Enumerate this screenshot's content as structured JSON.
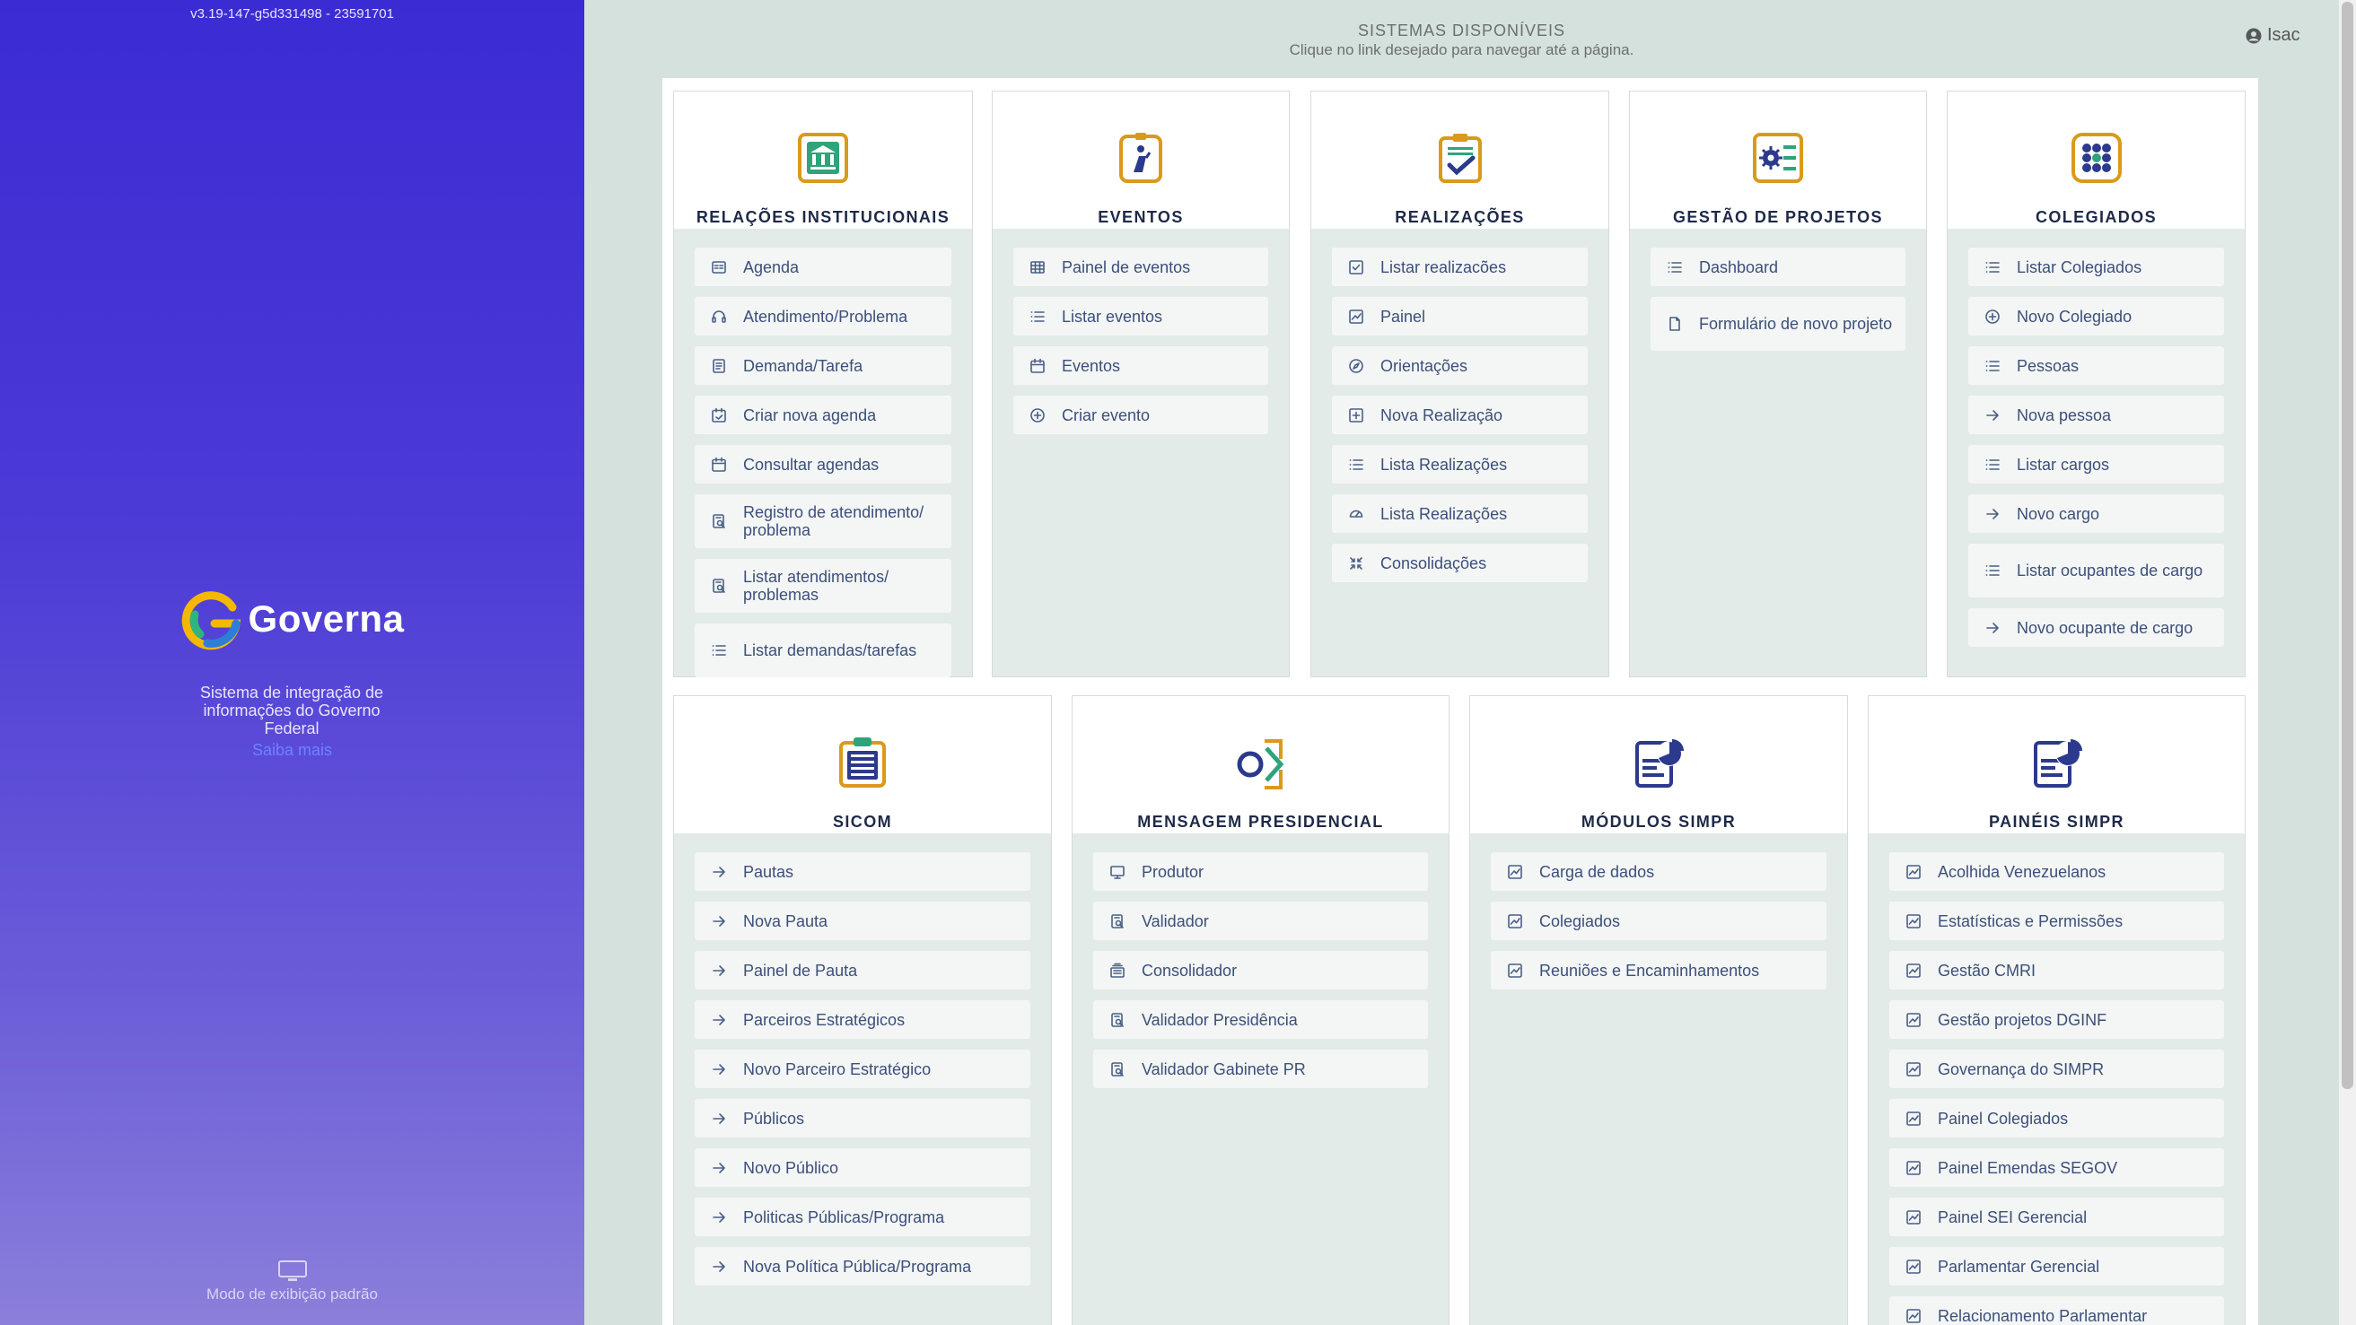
{
  "app": {
    "version": "v3.19-147-g5d331498 - 23591701",
    "brand_name": "Governa",
    "tagline": "Sistema de integração de informações do Governo Federal",
    "learn_more": "Saiba mais",
    "display_mode": "Modo de exibição padrão"
  },
  "header": {
    "title": "SISTEMAS DISPONÍVEIS",
    "subtitle": "Clique no link desejado para navegar até a página.",
    "user_name": "Isac"
  },
  "colors": {
    "sidebar_gradient_top": "#3b2bd3",
    "sidebar_gradient_bottom": "#8b7fda",
    "page_background": "#d5e1dd",
    "card_body": "#e3ebe8",
    "item_background": "#f3f6f5",
    "title_color": "#1f2a48",
    "link_color": "#3d4f7a",
    "icon_gold": "#d99a1c",
    "icon_navy": "#2b3a8c",
    "icon_green": "#2fa37a"
  },
  "cards": [
    {
      "title": "RELAÇÕES INSTITUCIONAIS",
      "icon": "institution-icon",
      "items": [
        {
          "label": "Agenda",
          "icon": "agenda-icon"
        },
        {
          "label": "Atendimento/Problema",
          "icon": "headset-icon"
        },
        {
          "label": "Demanda/Tarefa",
          "icon": "document-icon"
        },
        {
          "label": "Criar nova agenda",
          "icon": "calendar-check-icon"
        },
        {
          "label": "Consultar agendas",
          "icon": "calendar-icon"
        },
        {
          "label": "Registro de atendimento/ problema",
          "icon": "document-search-icon"
        },
        {
          "label": "Listar atendimentos/ problemas",
          "icon": "document-search-icon"
        },
        {
          "label": "Listar demandas/tarefas",
          "icon": "list-icon"
        }
      ]
    },
    {
      "title": "EVENTOS",
      "icon": "event-badge-icon",
      "items": [
        {
          "label": "Painel de eventos",
          "icon": "table-icon"
        },
        {
          "label": "Listar eventos",
          "icon": "list-icon"
        },
        {
          "label": "Eventos",
          "icon": "calendar-icon"
        },
        {
          "label": "Criar evento",
          "icon": "plus-circle-icon"
        }
      ]
    },
    {
      "title": "REALIZAÇÕES",
      "icon": "clipboard-check-icon",
      "items": [
        {
          "label": "Listar realizacões",
          "icon": "check-square-icon"
        },
        {
          "label": "Painel",
          "icon": "chart-icon"
        },
        {
          "label": "Orientações",
          "icon": "compass-icon"
        },
        {
          "label": "Nova Realização",
          "icon": "plus-square-icon"
        },
        {
          "label": "Lista Realizações",
          "icon": "list-icon"
        },
        {
          "label": "Lista Realizações",
          "icon": "gauge-icon"
        },
        {
          "label": "Consolidações",
          "icon": "collapse-icon"
        }
      ]
    },
    {
      "title": "GESTÃO DE PROJETOS",
      "icon": "project-settings-icon",
      "items": [
        {
          "label": "Dashboard",
          "icon": "list-icon"
        },
        {
          "label": "Formulário de novo projeto",
          "icon": "file-icon"
        }
      ]
    },
    {
      "title": "COLEGIADOS",
      "icon": "group-grid-icon",
      "items": [
        {
          "label": "Listar Colegiados",
          "icon": "list-icon"
        },
        {
          "label": "Novo Colegiado",
          "icon": "plus-circle-icon"
        },
        {
          "label": "Pessoas",
          "icon": "list-icon"
        },
        {
          "label": "Nova pessoa",
          "icon": "arrow-right-icon"
        },
        {
          "label": "Listar cargos",
          "icon": "list-icon"
        },
        {
          "label": "Novo cargo",
          "icon": "arrow-right-icon"
        },
        {
          "label": "Listar ocupantes de cargo",
          "icon": "list-icon"
        },
        {
          "label": "Novo ocupante de cargo",
          "icon": "arrow-right-icon"
        }
      ]
    },
    {
      "title": "SICOM",
      "icon": "clipboard-list-icon",
      "items": [
        {
          "label": "Pautas",
          "icon": "arrow-right-icon"
        },
        {
          "label": "Nova Pauta",
          "icon": "arrow-right-icon"
        },
        {
          "label": "Painel de Pauta",
          "icon": "arrow-right-icon"
        },
        {
          "label": "Parceiros Estratégicos",
          "icon": "arrow-right-icon"
        },
        {
          "label": "Novo Parceiro Estratégico",
          "icon": "arrow-right-icon"
        },
        {
          "label": "Públicos",
          "icon": "arrow-right-icon"
        },
        {
          "label": "Novo Público",
          "icon": "arrow-right-icon"
        },
        {
          "label": "Politicas Públicas/Programa",
          "icon": "arrow-right-icon"
        },
        {
          "label": "Nova Política Pública/Programa",
          "icon": "arrow-right-icon"
        }
      ]
    },
    {
      "title": "MENSAGEM PRESIDENCIAL",
      "icon": "message-arrow-icon",
      "items": [
        {
          "label": "Produtor",
          "icon": "monitor-icon"
        },
        {
          "label": "Validador",
          "icon": "document-search-icon"
        },
        {
          "label": "Consolidador",
          "icon": "stack-icon"
        },
        {
          "label": "Validador Presidência",
          "icon": "document-search-icon"
        },
        {
          "label": "Validador Gabinete PR",
          "icon": "document-search-icon"
        }
      ]
    },
    {
      "title": "MÓDULOS SIMPR",
      "icon": "report-pie-icon",
      "items": [
        {
          "label": "Carga de dados",
          "icon": "chart-icon"
        },
        {
          "label": "Colegiados",
          "icon": "chart-icon"
        },
        {
          "label": "Reuniões e Encaminhamentos",
          "icon": "chart-icon"
        }
      ]
    },
    {
      "title": "PAINÉIS SIMPR",
      "icon": "report-pie-icon",
      "items": [
        {
          "label": "Acolhida Venezuelanos",
          "icon": "chart-icon"
        },
        {
          "label": "Estatísticas e Permissões",
          "icon": "chart-icon"
        },
        {
          "label": "Gestão CMRI",
          "icon": "chart-icon"
        },
        {
          "label": "Gestão projetos DGINF",
          "icon": "chart-icon"
        },
        {
          "label": "Governança do SIMPR",
          "icon": "chart-icon"
        },
        {
          "label": "Painel Colegiados",
          "icon": "chart-icon"
        },
        {
          "label": "Painel Emendas SEGOV",
          "icon": "chart-icon"
        },
        {
          "label": "Painel SEI Gerencial",
          "icon": "chart-icon"
        },
        {
          "label": "Parlamentar Gerencial",
          "icon": "chart-icon"
        },
        {
          "label": "Relacionamento Parlamentar",
          "icon": "chart-icon"
        }
      ]
    }
  ]
}
